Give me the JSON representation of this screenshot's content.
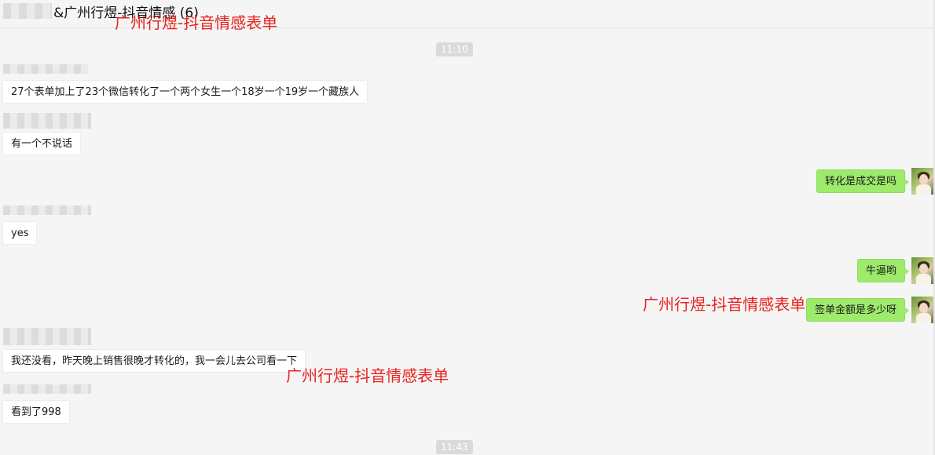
{
  "window": {
    "title": "&广州行煜-抖音情感 (6)"
  },
  "watermarks": [
    "广州行煜-抖音情感表单",
    "广州行煜-抖音情感表单",
    "广州行煜-抖音情感表单"
  ],
  "timestamps": [
    "11:10",
    "11:43"
  ],
  "messages": [
    {
      "side": "left",
      "text": "27个表单加上了23个微信转化了一个两个女生一个18岁一个19岁一个藏族人"
    },
    {
      "side": "left",
      "text": "有一个不说话"
    },
    {
      "side": "right",
      "text": "转化是成交是吗"
    },
    {
      "side": "left",
      "text": "yes"
    },
    {
      "side": "right",
      "text": "牛逼哟"
    },
    {
      "side": "right",
      "text": "签单金额是多少呀"
    },
    {
      "side": "left",
      "text": "我还没看，昨天晚上销售很晚才转化的，我一会儿去公司看一下"
    },
    {
      "side": "left",
      "text": "看到了998"
    }
  ],
  "colors": {
    "background": "#f5f5f5",
    "bubble_left": "#ffffff",
    "bubble_right": "#9eea6a",
    "watermark": "#e8231f",
    "timestamp_bg": "#dadada"
  }
}
